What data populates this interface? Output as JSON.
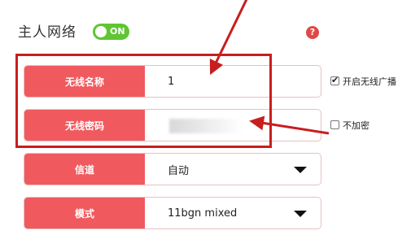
{
  "section": {
    "title": "主人网络",
    "toggle_label": "ON",
    "help_icon": "?"
  },
  "fields": [
    {
      "label": "无线名称",
      "value": "1"
    },
    {
      "label": "无线密码",
      "value": ""
    },
    {
      "label": "信道",
      "value": "自动"
    },
    {
      "label": "模式",
      "value": "11bgn mixed"
    }
  ],
  "checkboxes": [
    {
      "label": "开启无线广播",
      "checked": true
    },
    {
      "label": "不加密",
      "checked": false
    }
  ],
  "colors": {
    "label_bg": "#f05a5f",
    "toggle_on": "#5fc532",
    "annotation": "#c81e1e"
  }
}
